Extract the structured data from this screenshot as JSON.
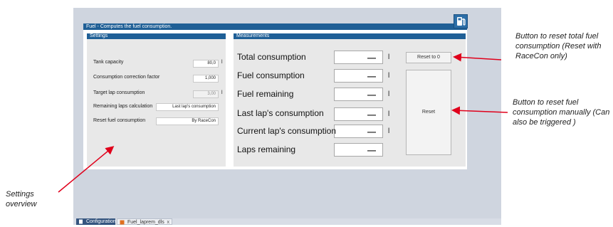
{
  "window": {
    "title": "Fuel - Computes the fuel consumption."
  },
  "settings": {
    "header": "Settings",
    "rows": [
      {
        "label": "Tank capacity",
        "value": "80,0",
        "unit": "l"
      },
      {
        "label": "Consumption correction factor",
        "value": "1,000",
        "unit": ""
      },
      {
        "label": "Target lap consumption",
        "value": "3,00",
        "unit": "l"
      },
      {
        "label": "Remaining laps calculation",
        "value": "Last lap's consumption",
        "unit": ""
      },
      {
        "label": "Reset fuel consumption",
        "value": "By RaceCon",
        "unit": ""
      }
    ]
  },
  "measurements": {
    "header": "Measurements",
    "rows": [
      {
        "label": "Total consumption",
        "value": "—",
        "unit": "l"
      },
      {
        "label": "Fuel consumption",
        "value": "—",
        "unit": "l"
      },
      {
        "label": "Fuel remaining",
        "value": "—",
        "unit": "l"
      },
      {
        "label": "Last lap's consumption",
        "value": "—",
        "unit": "l"
      },
      {
        "label": "Current lap's consumption",
        "value": "—",
        "unit": "l"
      },
      {
        "label": "Laps remaining",
        "value": "—",
        "unit": ""
      }
    ],
    "reset_to_0_label": "Reset to 0",
    "reset_label": "Reset"
  },
  "annotations": {
    "reset_total": "Button to reset total fuel consumption (Reset with RaceCon only)",
    "reset_manual": "Button to reset fuel consumption manually (Can also be triggered )",
    "settings_overview": "Settings overview"
  },
  "tabs": [
    {
      "label": "Configuration",
      "icon": "document-icon"
    },
    {
      "label": "Fuel_laprem_dls",
      "icon": "fuel-layout-icon",
      "close": "x"
    }
  ],
  "colors": {
    "titlebar": "#1f5f96",
    "canvas": "#cfd5df",
    "arrow": "#e0001b"
  }
}
